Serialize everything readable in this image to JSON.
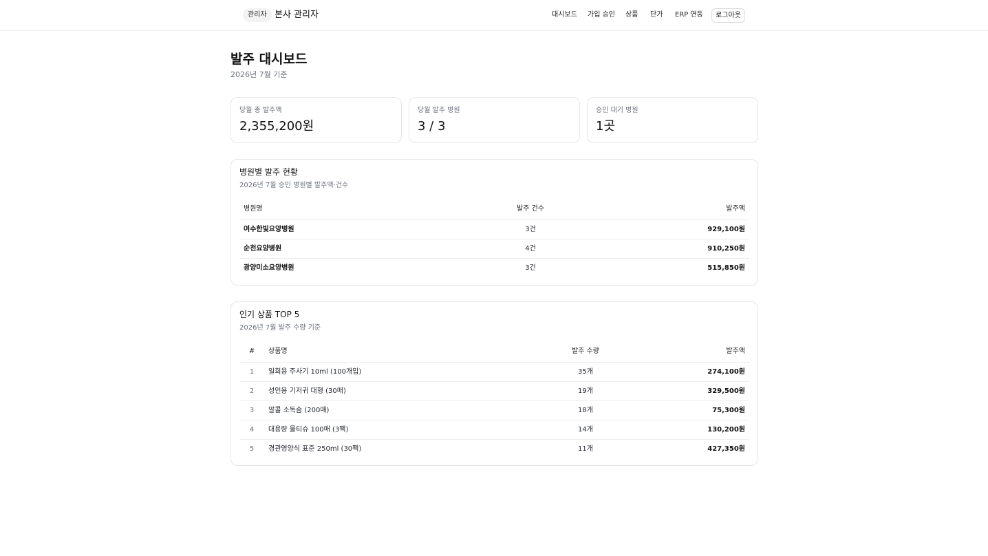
{
  "header": {
    "badge": "관리자",
    "title": "본사 관리자",
    "nav": [
      "대시보드",
      "가입 승인",
      "상품",
      "단가",
      "ERP 연동"
    ],
    "logout_label": "로그아웃"
  },
  "page": {
    "title": "발주 대시보드",
    "subtitle": "2026년 7월 기준"
  },
  "stats": [
    {
      "label": "당월 총 발주액",
      "value": "2,355,200원"
    },
    {
      "label": "당월 발주 병원",
      "value": "3 / 3"
    },
    {
      "label": "승인 대기 병원",
      "value": "1곳"
    }
  ],
  "hospital_card": {
    "title": "병원별 발주 현황",
    "subtitle": "2026년 7월 승인 병원별 발주액·건수",
    "columns": [
      "병원명",
      "발주 건수",
      "발주액"
    ],
    "rows": [
      {
        "name": "여수한빛요양병원",
        "count": "3건",
        "amount": "929,100원"
      },
      {
        "name": "순천요양병원",
        "count": "4건",
        "amount": "910,250원"
      },
      {
        "name": "광양미소요양병원",
        "count": "3건",
        "amount": "515,850원"
      }
    ]
  },
  "product_card": {
    "title": "인기 상품 TOP 5",
    "subtitle": "2026년 7월 발주 수량 기준",
    "columns": [
      "#",
      "상품명",
      "발주 수량",
      "발주액"
    ],
    "rows": [
      {
        "rank": "1",
        "name": "일회용 주사기 10ml (100개입)",
        "qty": "35개",
        "amount": "274,100원"
      },
      {
        "rank": "2",
        "name": "성인용 기저귀 대형 (30매)",
        "qty": "19개",
        "amount": "329,500원"
      },
      {
        "rank": "3",
        "name": "알콜 소독솜 (200매)",
        "qty": "18개",
        "amount": "75,300원"
      },
      {
        "rank": "4",
        "name": "대용량 물티슈 100매 (3팩)",
        "qty": "14개",
        "amount": "130,200원"
      },
      {
        "rank": "5",
        "name": "경관영양식 표준 250ml (30팩)",
        "qty": "11개",
        "amount": "427,350원"
      }
    ]
  }
}
